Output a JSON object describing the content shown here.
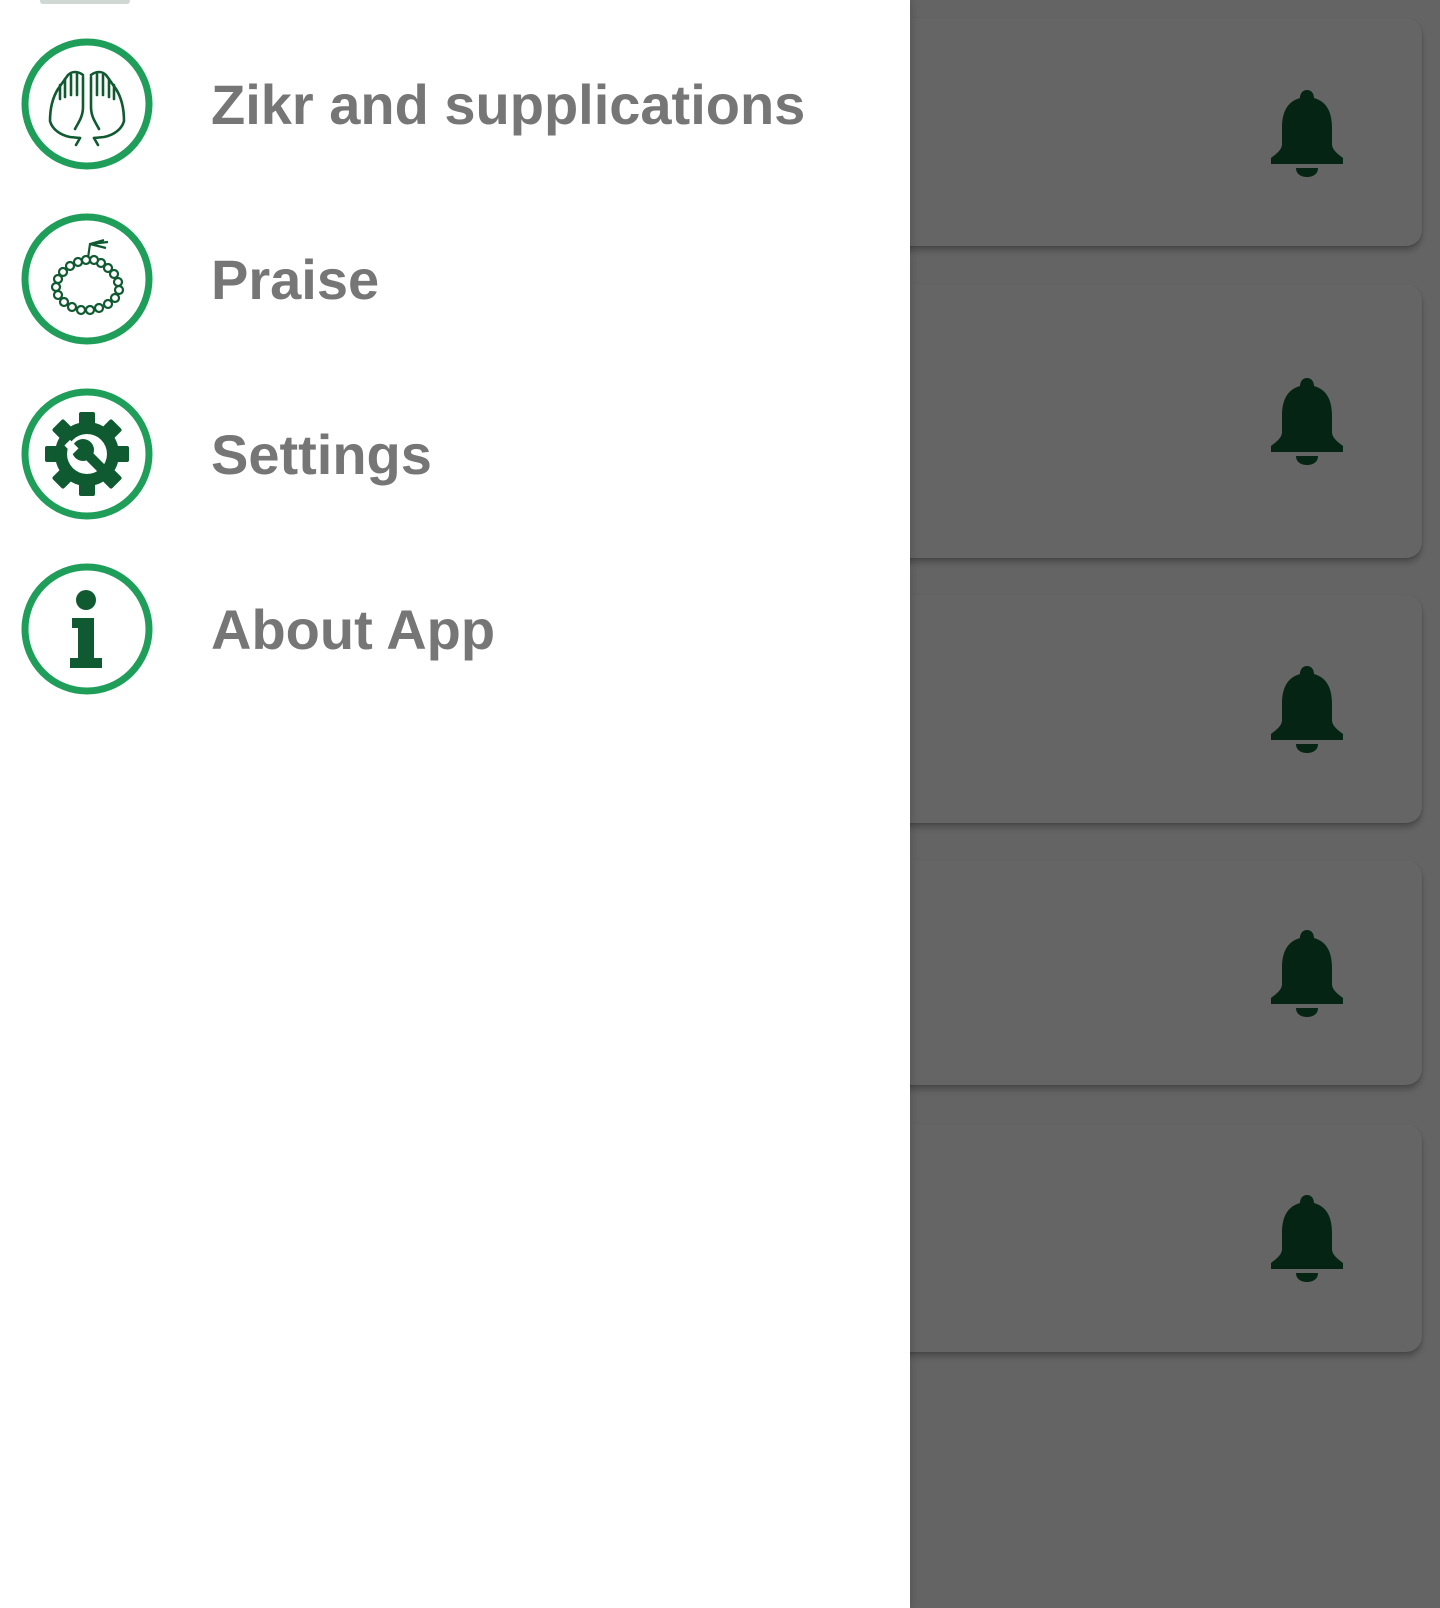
{
  "drawer": {
    "items": [
      {
        "label": "Zikr and supplications",
        "icon": "praying-hands-icon"
      },
      {
        "label": "Praise",
        "icon": "prayer-beads-icon"
      },
      {
        "label": "Settings",
        "icon": "gear-wrench-icon"
      },
      {
        "label": "About App",
        "icon": "info-icon"
      }
    ]
  },
  "background": {
    "cards": [
      {
        "icon": "bell-icon"
      },
      {
        "icon": "bell-icon"
      },
      {
        "icon": "bell-icon"
      },
      {
        "icon": "bell-icon"
      },
      {
        "icon": "bell-icon"
      }
    ]
  },
  "colors": {
    "accent_green": "#1f9e5a",
    "dark_green": "#0f5a30",
    "bell_green": "#062414",
    "scrim_gray": "#646464",
    "label_gray": "#767676"
  }
}
